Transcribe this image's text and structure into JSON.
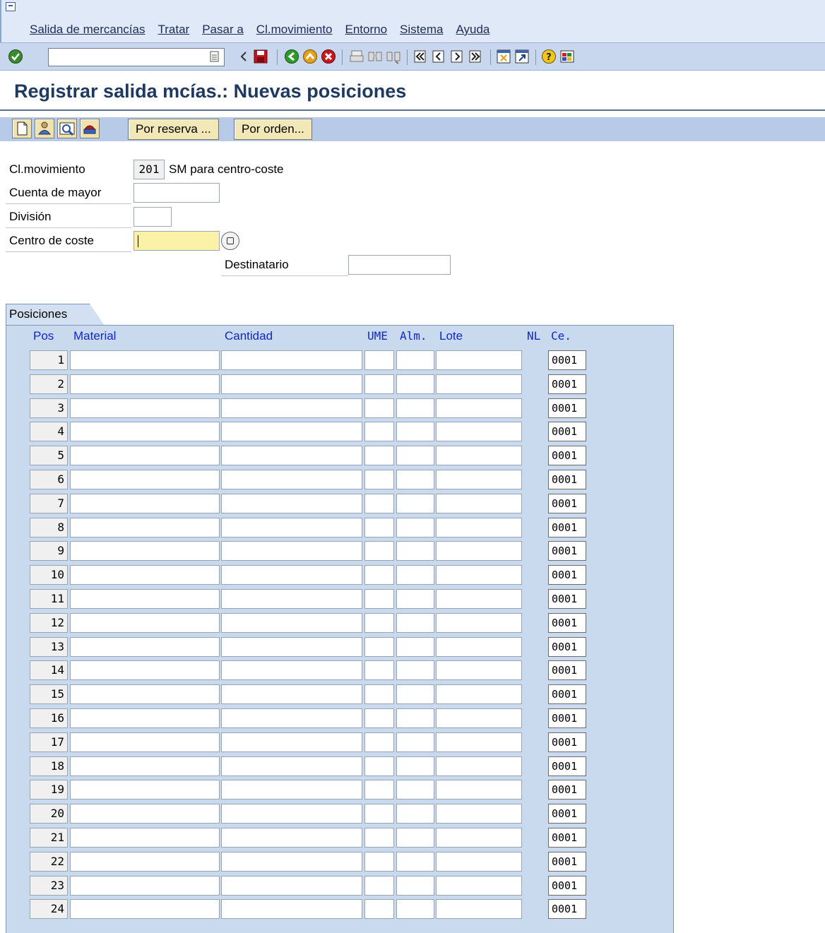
{
  "menu": {
    "items": [
      "Salida de mercancías",
      "Tratar",
      "Pasar a",
      "Cl.movimiento",
      "Entorno",
      "Sistema",
      "Ayuda"
    ]
  },
  "icons": {
    "menu_window": "window-menu-icon",
    "toolbar": [
      "enter-icon",
      "command-field-history-icon",
      "back-arrow-small-icon",
      "save-icon",
      "back-icon",
      "exit-icon",
      "cancel-icon",
      "print-icon",
      "find-icon",
      "find-next-icon",
      "first-page-icon",
      "previous-page-icon",
      "next-page-icon",
      "last-page-icon",
      "create-session-icon",
      "create-shortcut-icon",
      "help-icon",
      "customize-layout-icon"
    ],
    "app_toolbar": [
      "new-document-icon",
      "hold-data-icon",
      "check-icon",
      "post-icon"
    ]
  },
  "title": "Registrar salida mcías.: Nuevas posiciones",
  "app_buttons": {
    "por_reserva": "Por reserva ...",
    "por_orden": "Por orden..."
  },
  "header": {
    "cl_movimiento_label": "Cl.movimiento",
    "cl_movimiento_code": "201",
    "cl_movimiento_desc": "SM para centro-coste",
    "cuenta_mayor_label": "Cuenta de mayor",
    "cuenta_mayor_value": "",
    "division_label": "División",
    "division_value": "",
    "centro_coste_label": "Centro de coste",
    "centro_coste_value": "",
    "destinatario_label": "Destinatario",
    "destinatario_value": ""
  },
  "tab": {
    "label": "Posiciones"
  },
  "table": {
    "headers": {
      "pos": "Pos",
      "material": "Material",
      "cantidad": "Cantidad",
      "ume": "UME",
      "alm": "Alm.",
      "lote": "Lote",
      "nl": "NL",
      "ce": "Ce."
    },
    "rows": [
      {
        "pos": "1",
        "plant": "0001"
      },
      {
        "pos": "2",
        "plant": "0001"
      },
      {
        "pos": "3",
        "plant": "0001"
      },
      {
        "pos": "4",
        "plant": "0001"
      },
      {
        "pos": "5",
        "plant": "0001"
      },
      {
        "pos": "6",
        "plant": "0001"
      },
      {
        "pos": "7",
        "plant": "0001"
      },
      {
        "pos": "8",
        "plant": "0001"
      },
      {
        "pos": "9",
        "plant": "0001"
      },
      {
        "pos": "10",
        "plant": "0001"
      },
      {
        "pos": "11",
        "plant": "0001"
      },
      {
        "pos": "12",
        "plant": "0001"
      },
      {
        "pos": "13",
        "plant": "0001"
      },
      {
        "pos": "14",
        "plant": "0001"
      },
      {
        "pos": "15",
        "plant": "0001"
      },
      {
        "pos": "16",
        "plant": "0001"
      },
      {
        "pos": "17",
        "plant": "0001"
      },
      {
        "pos": "18",
        "plant": "0001"
      },
      {
        "pos": "19",
        "plant": "0001"
      },
      {
        "pos": "20",
        "plant": "0001"
      },
      {
        "pos": "21",
        "plant": "0001"
      },
      {
        "pos": "22",
        "plant": "0001"
      },
      {
        "pos": "23",
        "plant": "0001"
      },
      {
        "pos": "24",
        "plant": "0001"
      }
    ]
  },
  "colors": {
    "menu_bg": "#dfe9f7",
    "toolbar_bg": "#c8d7ee",
    "title": "#1f3a61",
    "panel_bg": "#c9d9ee",
    "column_header": "#0f27cc",
    "required_field": "#fcf2a7",
    "button_bg": "#f2e7b6"
  }
}
